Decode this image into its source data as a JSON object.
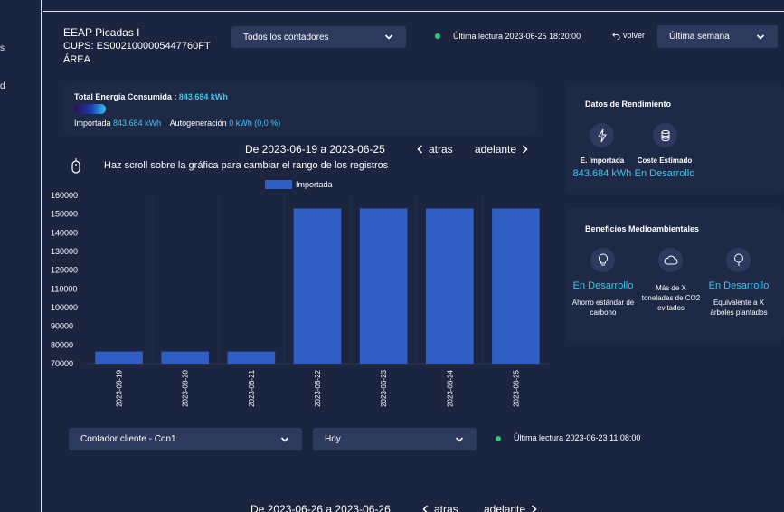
{
  "sidebar": {
    "items": [
      {
        "label": "s"
      },
      {
        "label": "d"
      }
    ]
  },
  "header": {
    "name": "EEAP Picadas I",
    "cups": "CUPS: ES0021000005447760FT",
    "area": "ÁREA",
    "meter_select": "Todos los contadores",
    "last_reading": "Última lectura 2023-06-25 18:20:00",
    "back_label": "volver",
    "period_select": "Última semana"
  },
  "energy": {
    "title_label": "Total Energía Consumida :",
    "total_value": "843.684 kWh",
    "imported_label": "Importada",
    "imported_value": "843.684 kWh",
    "self_gen_label": "Autogeneración",
    "self_gen_value": "0 kWh (0,0 %)"
  },
  "range_nav": {
    "range": "De 2023-06-19 a 2023-06-25",
    "prev_label": "atras",
    "next_label": "adelante",
    "scroll_hint": "Haz scroll sobre la gráfica para cambiar el rango de los registros"
  },
  "chart_data": {
    "type": "bar",
    "categories": [
      "2023-06-19",
      "2023-06-20",
      "2023-06-21",
      "2023-06-22",
      "2023-06-23",
      "2023-06-24",
      "2023-06-25"
    ],
    "series": [
      {
        "name": "Importada",
        "values": [
          76500,
          76500,
          76500,
          153000,
          153000,
          153000,
          153000
        ]
      }
    ],
    "yticks": [
      70000,
      80000,
      90000,
      100000,
      110000,
      120000,
      130000,
      140000,
      150000,
      160000
    ],
    "ylim": [
      70000,
      160000
    ],
    "color": "#2f5ec4",
    "legend_position": "top"
  },
  "performance": {
    "title": "Datos de Rendimiento",
    "imported_label": "E. Importada",
    "imported_value": "843.684 kWh",
    "cost_label": "Coste Estimado",
    "cost_value": "En Desarrollo",
    "icons": [
      "bolt-icon",
      "coins-icon"
    ]
  },
  "environment": {
    "title": "Beneficios Medioambientales",
    "items": [
      {
        "value": "En Desarrollo",
        "desc": "Ahorro estándar de carbono",
        "icon": "lightbulb-icon"
      },
      {
        "value": "",
        "desc": "Más de X toneladas de CO2 evitados",
        "icon": "cloud-icon"
      },
      {
        "value": "En Desarrollo",
        "desc": "Equivalente a X árboles plantados",
        "icon": "tree-icon"
      }
    ]
  },
  "second": {
    "meter_select": "Contador cliente - Con1",
    "period_select": "Hoy",
    "last_reading": "Última lectura 2023-06-23 11:08:00",
    "range": "De 2023-06-26 a 2023-06-26",
    "prev_label": "atras",
    "next_label": "adelante"
  }
}
